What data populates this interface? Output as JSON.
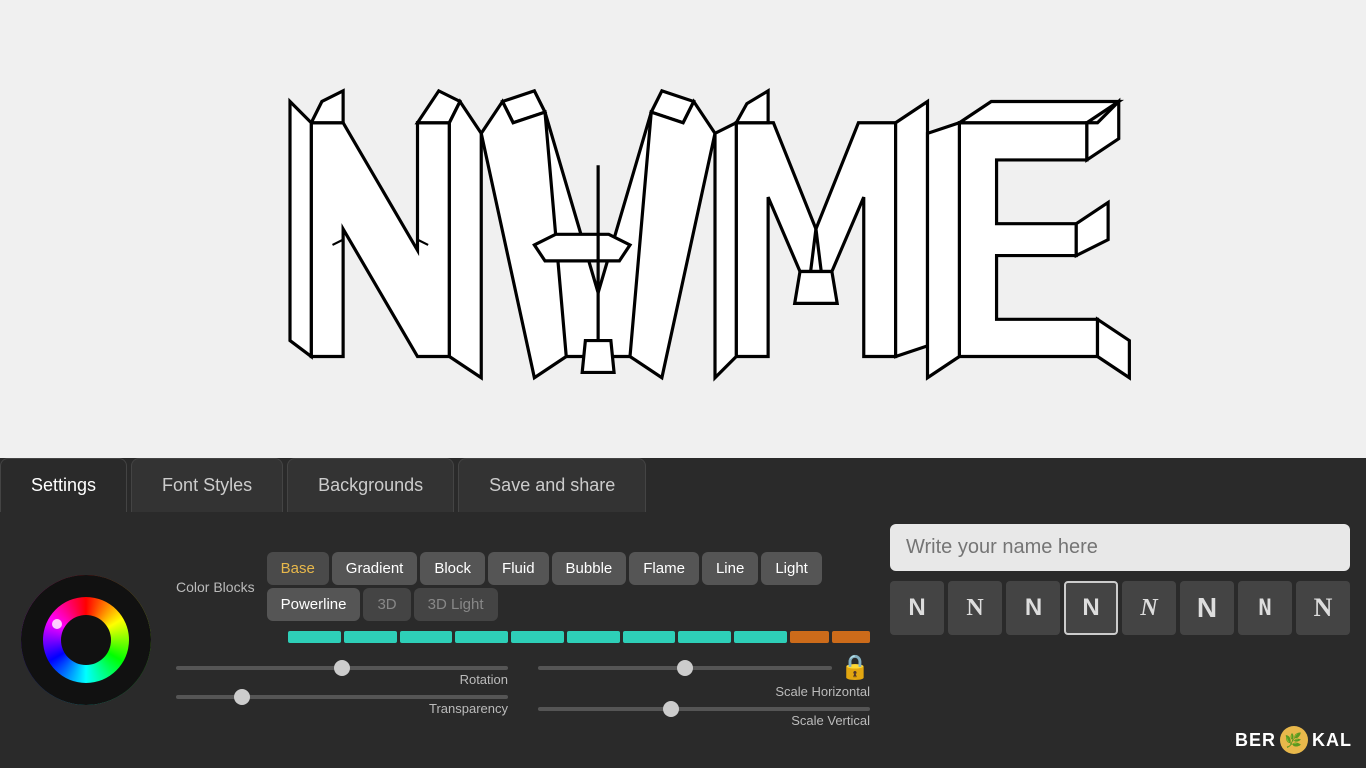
{
  "canvas": {
    "background": "#f0f0f0"
  },
  "tabs": [
    {
      "label": "Settings",
      "active": true
    },
    {
      "label": "Font Styles",
      "active": false
    },
    {
      "label": "Backgrounds",
      "active": false
    },
    {
      "label": "Save and share",
      "active": false
    }
  ],
  "controls": {
    "color_blocks_label": "Color Blocks",
    "style_buttons": [
      {
        "label": "Base",
        "active": true
      },
      {
        "label": "Gradient",
        "active": false
      },
      {
        "label": "Block",
        "active": false
      },
      {
        "label": "Fluid",
        "active": false
      },
      {
        "label": "Bubble",
        "active": false
      },
      {
        "label": "Flame",
        "active": false
      },
      {
        "label": "Line",
        "active": false
      },
      {
        "label": "Light",
        "active": false
      },
      {
        "label": "Powerline",
        "active": false
      },
      {
        "label": "3D",
        "active": false,
        "disabled": true
      },
      {
        "label": "3D Light",
        "active": false,
        "disabled": true
      }
    ],
    "sliders": {
      "rotation_label": "Rotation",
      "transparency_label": "Transparency",
      "scale_horizontal_label": "Scale Horizontal",
      "scale_vertical_label": "Scale Vertical",
      "rotation_value": 50,
      "transparency_value": 20,
      "scale_horizontal_value": 50,
      "scale_vertical_value": 40
    }
  },
  "input": {
    "placeholder": "Write your name here",
    "value": ""
  },
  "name_styles": [
    {
      "letter": "N",
      "style": "plain"
    },
    {
      "letter": "N",
      "style": "serif"
    },
    {
      "letter": "N",
      "style": "block"
    },
    {
      "letter": "N",
      "style": "outline"
    },
    {
      "letter": "N",
      "style": "bold"
    },
    {
      "letter": "N",
      "style": "italic"
    },
    {
      "letter": "N",
      "style": "narrow"
    },
    {
      "letter": "N",
      "style": "small"
    }
  ],
  "logo": {
    "text": "BERIKAL",
    "leaf_symbol": "🌿"
  }
}
